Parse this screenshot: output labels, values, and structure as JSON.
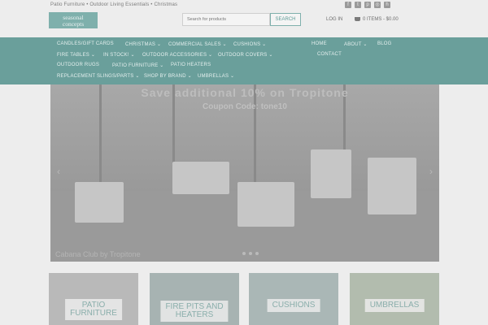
{
  "header": {
    "tagline": "Patio Furniture • Outdoor Living Essentials • Christmas",
    "logo_line1": "seasonal",
    "logo_line2": "concepts",
    "search_placeholder": "Search for products",
    "search_button": "SEARCH",
    "login": "LOG IN",
    "cart": "0 ITEMS - $0.00",
    "social": [
      "facebook-icon",
      "twitter-icon",
      "pinterest-icon",
      "instagram-icon",
      "houzz-icon"
    ]
  },
  "nav": {
    "left": [
      [
        "CANDLES/GIFT CARDS",
        "CHRISTMAS ⌄",
        "COMMERCIAL SALES ⌄",
        "CUSHIONS ⌄"
      ],
      [
        "FIRE TABLES ⌄",
        "IN STOCK! ⌄",
        "OUTDOOR ACCESSORIES ⌄",
        "OUTDOOR COVERS ⌄"
      ],
      [
        "OUTDOOR RUGS",
        "PATIO FURNITURE ⌄",
        "PATIO HEATERS"
      ],
      [
        "REPLACEMENT SLINGS/PARTS ⌄",
        "SHOP BY BRAND ⌄",
        "UMBRELLAS ⌄"
      ]
    ],
    "right": [
      "HOME",
      "ABOUT ⌄",
      "BLOG",
      "CONTACT"
    ]
  },
  "hero": {
    "promo_line1": "Save additional 10% on Tropitone",
    "promo_line2": "Coupon Code: tone10",
    "caption": "Cabana Club by Tropitone"
  },
  "tiles": [
    {
      "label": "PATIO\nFURNITURE",
      "color": "#b9b9b9"
    },
    {
      "label": "FIRE PITS AND\nHEATERS",
      "color": "#a7b3b2"
    },
    {
      "label": "CUSHIONS",
      "color": "#aab7b6"
    },
    {
      "label": "UMBRELLAS",
      "color": "#b2bcae"
    }
  ]
}
